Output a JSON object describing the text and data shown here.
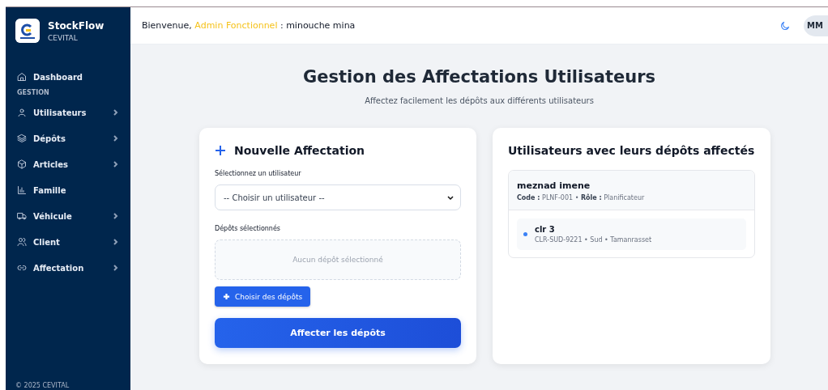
{
  "sidebar": {
    "brand": "StockFlow",
    "company": "CEVITAL",
    "items": [
      {
        "kind": "link",
        "label": "Dashboard",
        "has_submenu": false
      },
      {
        "kind": "section",
        "label": "GESTION"
      },
      {
        "kind": "link",
        "label": "Utilisateurs",
        "has_submenu": true
      },
      {
        "kind": "link",
        "label": "Dépôts",
        "has_submenu": true
      },
      {
        "kind": "link",
        "label": "Articles",
        "has_submenu": true
      },
      {
        "kind": "link",
        "label": "Famille",
        "has_submenu": false
      },
      {
        "kind": "link",
        "label": "Véhicule",
        "has_submenu": true
      },
      {
        "kind": "link",
        "label": "Client",
        "has_submenu": true
      },
      {
        "kind": "link",
        "label": "Affectation",
        "has_submenu": true
      }
    ],
    "footer": "© 2025 CEVITAL"
  },
  "header": {
    "greeting": "Bienvenue,",
    "role": "Admin Fonctionnel",
    "user": ": minouche mina",
    "avatar": "MM"
  },
  "page": {
    "title": "Gestion des Affectations Utilisateurs",
    "subtitle": "Affectez facilement les dépôts aux différents utilisateurs"
  },
  "form": {
    "title": "Nouvelle Affectation",
    "user_label": "Sélectionnez un utilisateur",
    "user_select": "-- Choisir un utilisateur --",
    "depots_label": "Dépôts sélectionnés",
    "depots_empty": "Aucun dépôt sélectionné",
    "choose_button": "Choisir des dépôts",
    "submit_button": "Affecter les dépôts"
  },
  "assignments": {
    "title": "Utilisateurs avec leurs dépôts affectés",
    "users": [
      {
        "name": "meznad imene",
        "meta": "**Code :** PLNF-001 • **Rôle :** Planificateur",
        "depots": [
          {
            "name": "clr 3",
            "details": "CLR-SUD-9221 • Sud • Tamanrasset",
            "color": "#3b82f6"
          }
        ]
      }
    ]
  }
}
